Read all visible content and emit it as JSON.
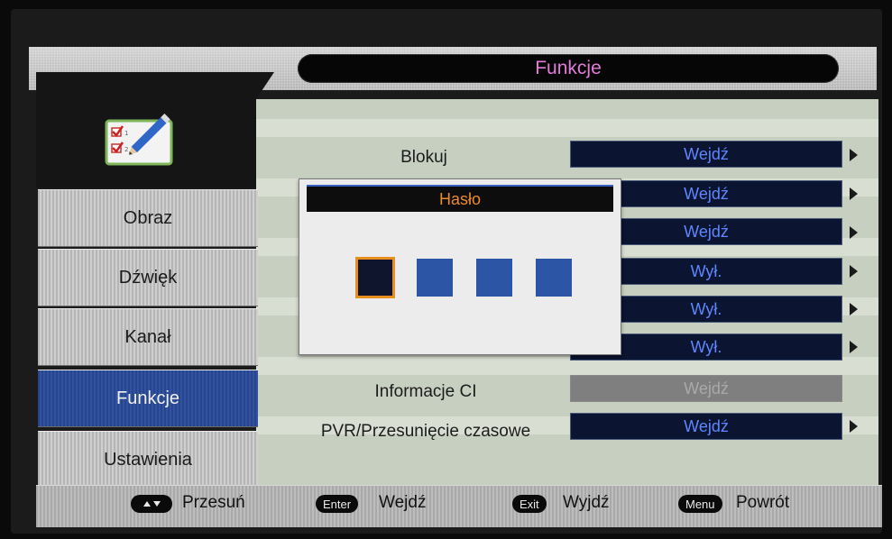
{
  "header": {
    "title": "Funkcje"
  },
  "sidebar": {
    "items": [
      {
        "label": "Obraz"
      },
      {
        "label": "Dźwięk"
      },
      {
        "label": "Kanał"
      },
      {
        "label": "Funkcje",
        "active": true
      },
      {
        "label": "Ustawienia"
      }
    ]
  },
  "options": [
    {
      "label": "Blokuj",
      "value": "Wejdź"
    },
    {
      "label": "",
      "value": "Wejdź"
    },
    {
      "label": "",
      "value": "Wejdź"
    },
    {
      "label": "",
      "value": "Wył."
    },
    {
      "label": "",
      "value": "Wył."
    },
    {
      "label": "",
      "value": "Wył."
    },
    {
      "label": "Informacje CI",
      "value": "Wejdź",
      "disabled": true
    },
    {
      "label": "PVR/Przesunięcie czasowe",
      "value": "Wejdź"
    }
  ],
  "dialog": {
    "title": "Hasło",
    "pin_length": 4,
    "active_digit": 1
  },
  "footer": {
    "move_label": "Przesuń",
    "enter_key": "Enter",
    "enter_label": "Wejdź",
    "exit_key": "Exit",
    "exit_label": "Wyjdź",
    "menu_key": "Menu",
    "menu_label": "Powrót"
  },
  "colors": {
    "title": "#e27cd8",
    "active_menu": "#2d4f9c",
    "value_text": "#5e86ff",
    "dialog_title": "#ee8a2a",
    "pin_active_border": "#e88e1e"
  }
}
